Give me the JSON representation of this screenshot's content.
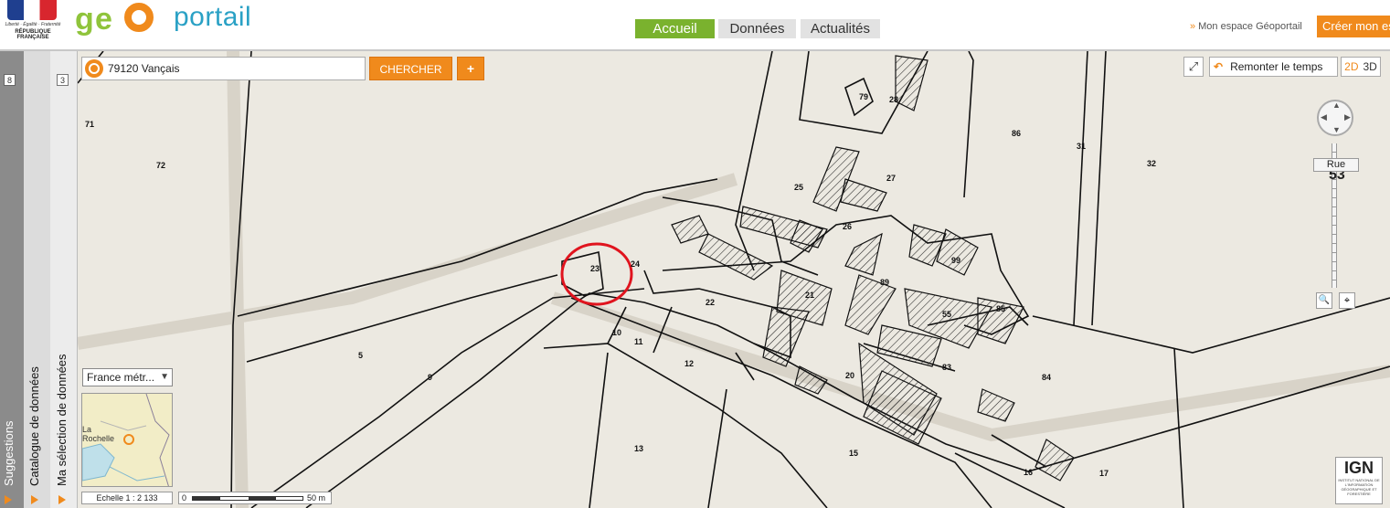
{
  "header": {
    "gov_motto": "Liberté · Égalité · Fraternité",
    "gov_name": "RÉPUBLIQUE FRANÇAISE",
    "logo_g": "g",
    "logo_e": "e",
    "logo_portail": "portail",
    "nav": [
      {
        "label": "Accueil",
        "active": true
      },
      {
        "label": "Données",
        "active": false
      },
      {
        "label": "Actualités",
        "active": false
      }
    ],
    "my_space": "Mon espace Géoportail",
    "create_button": "Créer mon es"
  },
  "sidebars": {
    "suggestions": {
      "label": "Suggestions",
      "count": "8"
    },
    "catalogue": {
      "label": "Catalogue de données"
    },
    "selection": {
      "label": "Ma sélection de données",
      "count": "3"
    }
  },
  "search": {
    "value": "79120 Vançais",
    "search_button": "CHERCHER",
    "plus_button": "+"
  },
  "tools": {
    "fullscreen_icon": "⤢",
    "time_button": "Remonter le temps",
    "mode_2d": "2D",
    "mode_3d": "3D",
    "zoom_label": "Rue",
    "zoom_level": "53",
    "zoom_box_icon": "🔍",
    "locate_icon": "⌖"
  },
  "overview": {
    "projection": "France métr...",
    "city_label_1": "La",
    "city_label_2": "Rochelle"
  },
  "scale": {
    "ratio_label": "Echelle 1 :",
    "ratio_value": "2 133",
    "bar_start": "0",
    "bar_end": "50 m"
  },
  "ign": {
    "name": "IGN",
    "subtitle": "INSTITUT NATIONAL DE L'INFORMATION GÉOGRAPHIQUE ET FORESTIÈRE"
  },
  "parcels": [
    "71",
    "72",
    "79",
    "28",
    "86",
    "31",
    "32",
    "25",
    "27",
    "26",
    "23",
    "24",
    "99",
    "22",
    "21",
    "89",
    "55",
    "85",
    "10",
    "11",
    "5",
    "9",
    "12",
    "20",
    "83",
    "84",
    "13",
    "15",
    "16",
    "17"
  ],
  "colors": {
    "accent_orange": "#f08a1c",
    "accent_green": "#7ab22e",
    "logo_blue": "#2aa1c5",
    "map_bg": "#ece9e1",
    "highlight_red": "#e0141e"
  }
}
